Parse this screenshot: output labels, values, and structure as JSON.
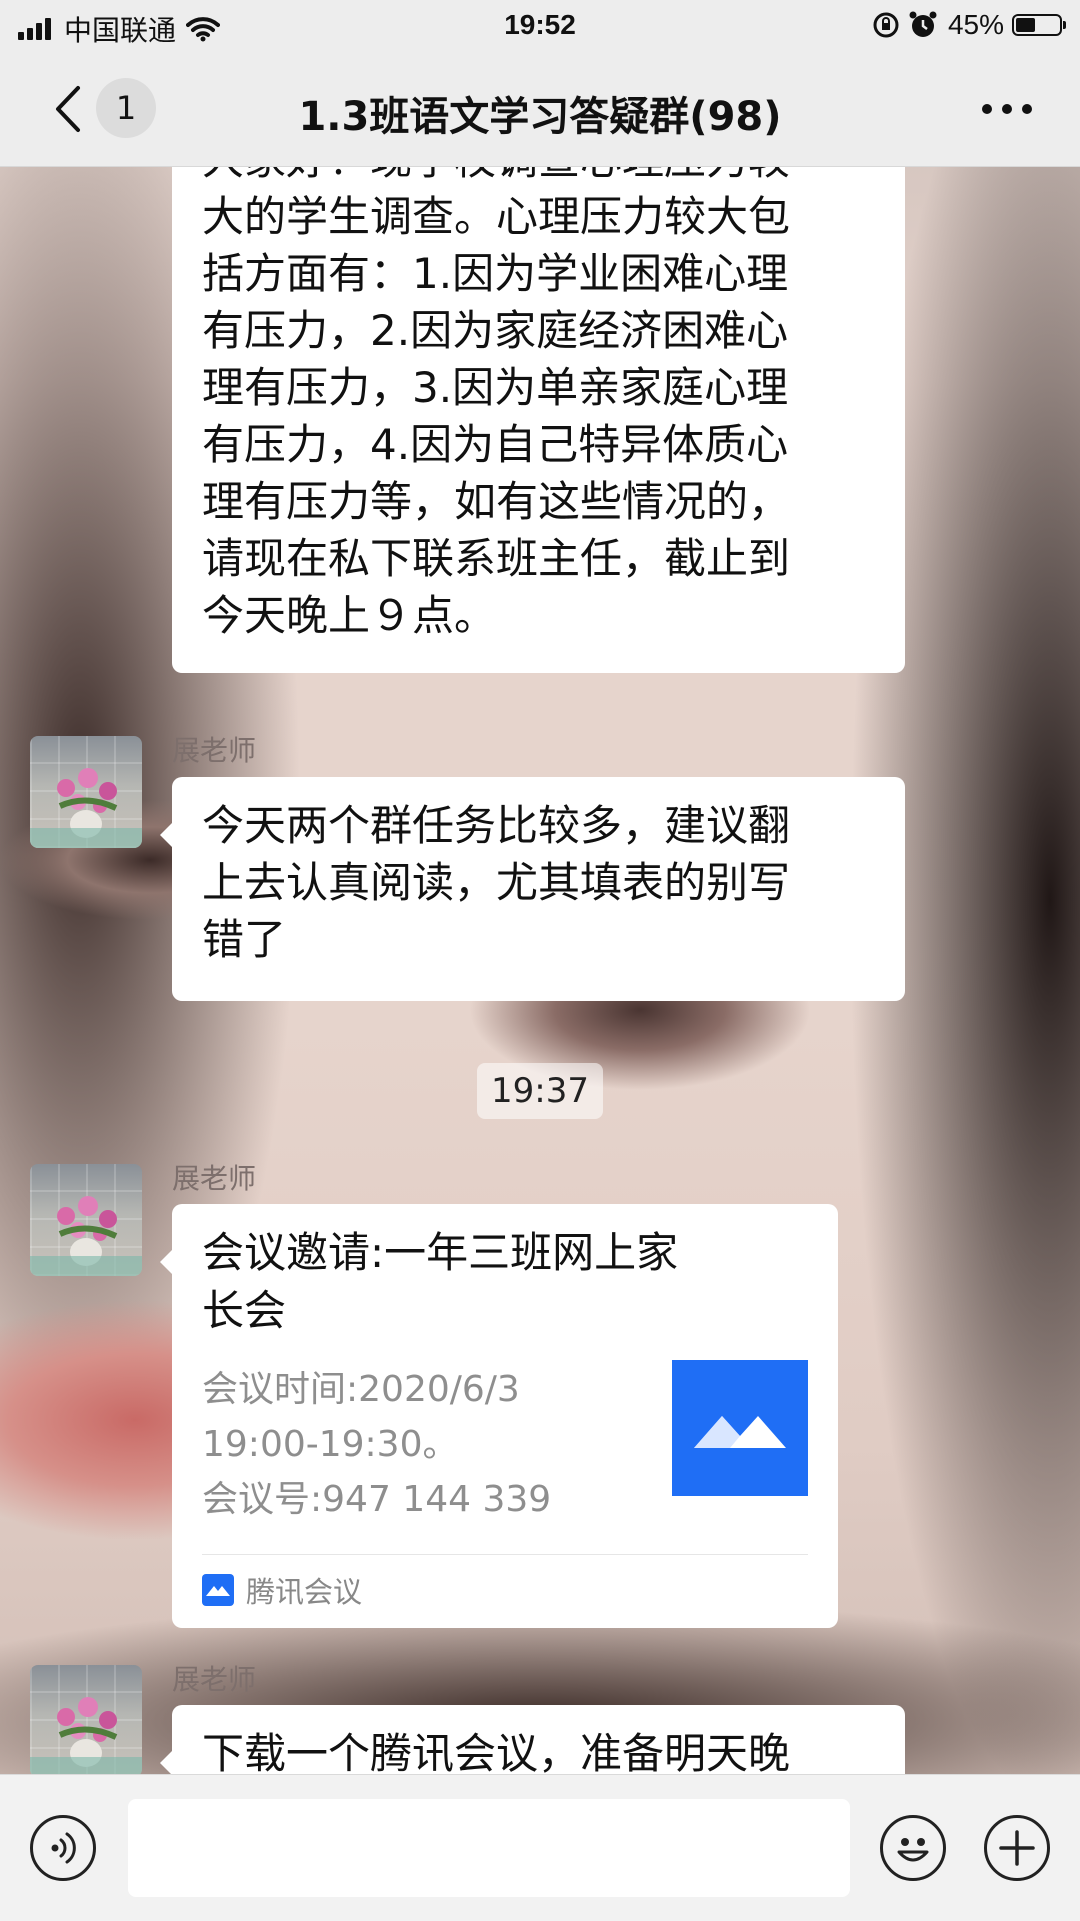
{
  "status_bar": {
    "carrier": "中国联通",
    "time": "19:52",
    "battery": "45%",
    "battery_level": 0.45
  },
  "nav": {
    "title": "1.3班语文学习答疑群(98)",
    "unread_count": "1"
  },
  "messages": [
    {
      "type": "text",
      "lines": [
        "大家好！现学校调查心理压力较",
        "大的学生调查。心理压力较大包",
        "括方面有：1.因为学业困难心理",
        "有压力，2.因为家庭经济困难心",
        "理有压力，3.因为单亲家庭心理",
        "有压力，4.因为自己特异体质心",
        "理有压力等，如有这些情况的，",
        "请现在私下联系班主任，截止到",
        "今天晚上９点。"
      ]
    },
    {
      "type": "text",
      "sender": "展老师",
      "lines": [
        "今天两个群任务比较多，建议翻",
        "上去认真阅读，尤其填表的别写",
        "错了"
      ]
    },
    {
      "type": "time",
      "label": "19:37"
    },
    {
      "type": "card",
      "sender": "展老师",
      "title_lines": [
        "会议邀请:一年三班网上家",
        "长会"
      ],
      "desc_lines": [
        "会议时间:2020/6/3",
        "19:00-19:30。",
        "会议号:947 144 339"
      ],
      "source": "腾讯会议"
    },
    {
      "type": "text",
      "sender": "展老师",
      "lines": [
        "下载一个腾讯会议，准备明天晚"
      ]
    }
  ],
  "input": {
    "value": "",
    "placeholder": ""
  },
  "colors": {
    "chat_bubble": "#ffffff",
    "bar_background": "#ededed",
    "tencent_meeting_blue": "#1f6ef5"
  },
  "icons": {
    "back": "chevron-left-icon",
    "more": "more-dots-icon",
    "voice": "voice-icon",
    "emoji": "emoji-icon",
    "plus": "plus-icon"
  }
}
